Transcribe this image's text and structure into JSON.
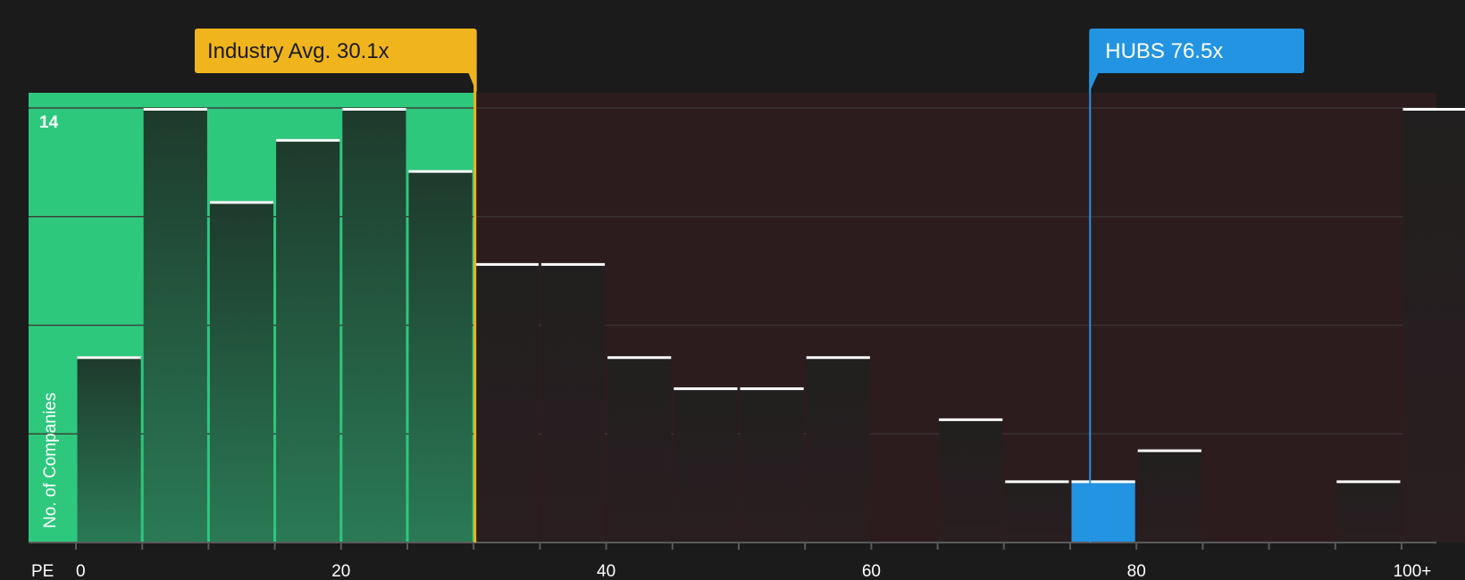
{
  "chart_data": {
    "type": "bar",
    "xlabel": "PE",
    "ylabel": "No. of Companies",
    "x_tick_labels": [
      "0",
      "20",
      "40",
      "60",
      "80",
      "100+"
    ],
    "x_tick_values": [
      0,
      20,
      40,
      60,
      80,
      100
    ],
    "y_tick_labels": [
      "14"
    ],
    "y_tick_values": [
      14
    ],
    "ylim": [
      0,
      14
    ],
    "bin_width": 5,
    "bins": [
      {
        "start": 0,
        "value": 6
      },
      {
        "start": 5,
        "value": 14
      },
      {
        "start": 10,
        "value": 11
      },
      {
        "start": 15,
        "value": 13
      },
      {
        "start": 20,
        "value": 14
      },
      {
        "start": 25,
        "value": 12
      },
      {
        "start": 30,
        "value": 9
      },
      {
        "start": 35,
        "value": 9
      },
      {
        "start": 40,
        "value": 6
      },
      {
        "start": 45,
        "value": 5
      },
      {
        "start": 50,
        "value": 5
      },
      {
        "start": 55,
        "value": 6
      },
      {
        "start": 60,
        "value": 0
      },
      {
        "start": 65,
        "value": 4
      },
      {
        "start": 70,
        "value": 2
      },
      {
        "start": 75,
        "value": 2
      },
      {
        "start": 80,
        "value": 3
      },
      {
        "start": 85,
        "value": 0
      },
      {
        "start": 90,
        "value": 0
      },
      {
        "start": 95,
        "value": 2
      },
      {
        "start": 100,
        "value": 14
      }
    ],
    "grid": true,
    "industry_avg": {
      "label": "Industry Avg. 30.1x",
      "value": 30.1
    },
    "company": {
      "label": "HUBS 76.5x",
      "value": 76.5
    },
    "colors": {
      "background": "#1b1b1b",
      "undervalued_region": "#2ec87d",
      "overvalued_region": "#2d1c1e",
      "industry_marker": "#f0b41c",
      "company_marker": "#2394e2",
      "bar_in_green": "#1f3f30",
      "bar_in_dark": "#232020",
      "bar_top": "#ffffff",
      "axis": "#5a5a5a",
      "grid": "#3d3536"
    }
  }
}
